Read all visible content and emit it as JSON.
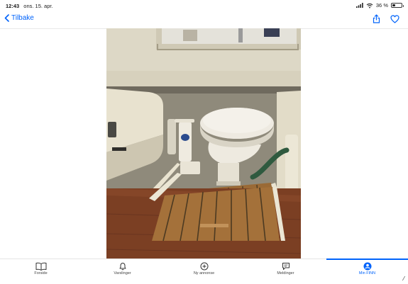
{
  "status_bar": {
    "time": "12:43",
    "date": "ons. 15. apr.",
    "battery": "36 %",
    "battery_level": 0.36
  },
  "nav": {
    "back_label": "Tilbake",
    "share_icon": "share-icon",
    "favorite_icon": "heart-icon",
    "accent": "#0063fb"
  },
  "photo": {
    "subject": "toilet-photo"
  },
  "tab_bar": {
    "items": [
      {
        "label": "Forside",
        "icon": "book-icon"
      },
      {
        "label": "Varslinger",
        "icon": "bell-icon"
      },
      {
        "label": "Ny annonse",
        "icon": "plus-circle-icon"
      },
      {
        "label": "Meldinger",
        "icon": "chat-icon"
      },
      {
        "label": "Min FINN",
        "icon": "profile-icon"
      }
    ],
    "active_index": 4
  }
}
